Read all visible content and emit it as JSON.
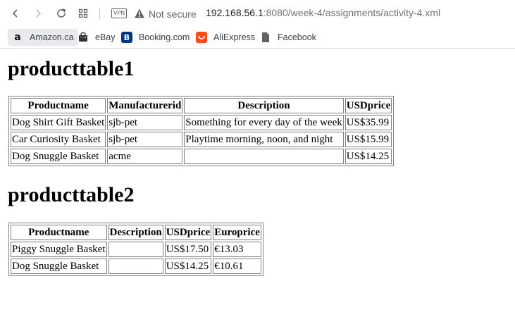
{
  "browser": {
    "vpn_label": "VPN",
    "security_text": "Not secure",
    "url_host": "192.168.56.1",
    "url_path": ":8080/week-4/assignments/activity-4.xml"
  },
  "bookmarks": [
    {
      "label": "Amazon.ca",
      "icon": "amazon-icon"
    },
    {
      "label": "eBay",
      "icon": "ebay-icon"
    },
    {
      "label": "Booking.com",
      "icon": "booking-icon"
    },
    {
      "label": "AliExpress",
      "icon": "aliexpress-icon"
    },
    {
      "label": "Facebook",
      "icon": "file-icon"
    }
  ],
  "table1": {
    "heading": "producttable1",
    "headers": [
      "Productname",
      "Manufacturerid",
      "Description",
      "USDprice"
    ],
    "rows": [
      [
        "Dog Shirt Gift Basket",
        "sjb-pet",
        "Something for every day of the week",
        "US$35.99"
      ],
      [
        "Car Curiosity Basket",
        "sjb-pet",
        "Playtime morning, noon, and night",
        "US$15.99"
      ],
      [
        "Dog Snuggle Basket",
        "acme",
        "",
        "US$14.25"
      ]
    ]
  },
  "table2": {
    "heading": "producttable2",
    "headers": [
      "Productname",
      "Description",
      "USDprice",
      "Europrice"
    ],
    "rows": [
      [
        "Piggy Snuggle Basket",
        "",
        "US$17.50",
        "€13.03"
      ],
      [
        "Dog Snuggle Basket",
        "",
        "US$14.25",
        "€10.61"
      ]
    ]
  }
}
